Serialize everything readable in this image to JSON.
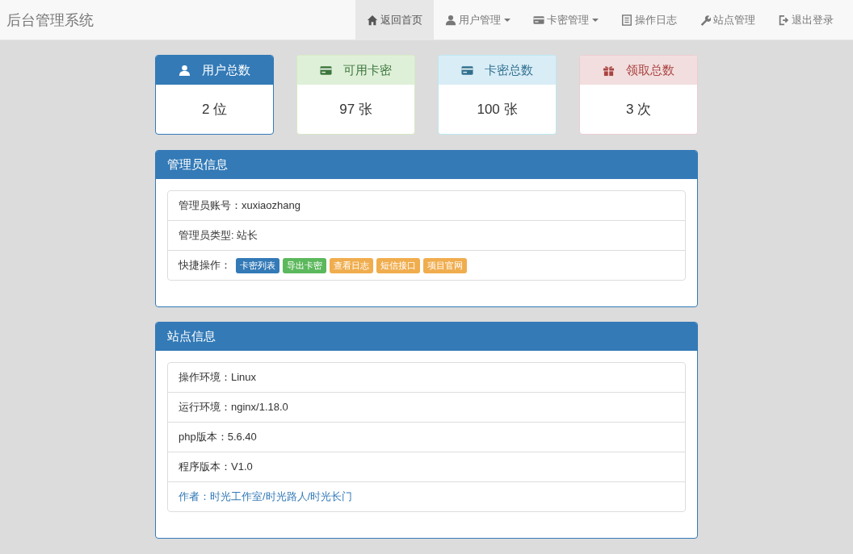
{
  "navbar": {
    "brand": "后台管理系统",
    "items": [
      {
        "label": "返回首页",
        "selected": true,
        "dropdown": false
      },
      {
        "label": "用户管理",
        "selected": false,
        "dropdown": true
      },
      {
        "label": "卡密管理",
        "selected": false,
        "dropdown": true
      },
      {
        "label": "操作日志",
        "selected": false,
        "dropdown": false
      },
      {
        "label": "站点管理",
        "selected": false,
        "dropdown": false
      },
      {
        "label": "退出登录",
        "selected": false,
        "dropdown": false
      }
    ]
  },
  "stats": [
    {
      "kind": "primary",
      "title": "用户总数",
      "value": "2 位"
    },
    {
      "kind": "success",
      "title": "可用卡密",
      "value": "97 张"
    },
    {
      "kind": "info",
      "title": "卡密总数",
      "value": "100 张"
    },
    {
      "kind": "danger",
      "title": "领取总数",
      "value": "3 次"
    }
  ],
  "admin_panel": {
    "title": "管理员信息",
    "rows": [
      {
        "kind": "text",
        "text": "管理员账号：xuxiaozhang"
      },
      {
        "kind": "text",
        "text": "管理员类型: 站长"
      },
      {
        "kind": "actions",
        "text": "快捷操作：",
        "buttons": [
          {
            "label": "卡密列表",
            "kind": "primary"
          },
          {
            "label": "导出卡密",
            "kind": "success"
          },
          {
            "label": "查看日志",
            "kind": "warning"
          },
          {
            "label": "短信接口",
            "kind": "warning"
          },
          {
            "label": "项目官网",
            "kind": "warning"
          }
        ]
      }
    ]
  },
  "site_panel": {
    "title": "站点信息",
    "rows": [
      {
        "kind": "text",
        "text": "操作环境：Linux"
      },
      {
        "kind": "text",
        "text": "运行环境：nginx/1.18.0"
      },
      {
        "kind": "text",
        "text": "php版本：5.6.40"
      },
      {
        "kind": "text",
        "text": "程序版本：V1.0"
      },
      {
        "kind": "link",
        "text": "作者：时光工作室/时光路人/时光长门"
      }
    ]
  }
}
